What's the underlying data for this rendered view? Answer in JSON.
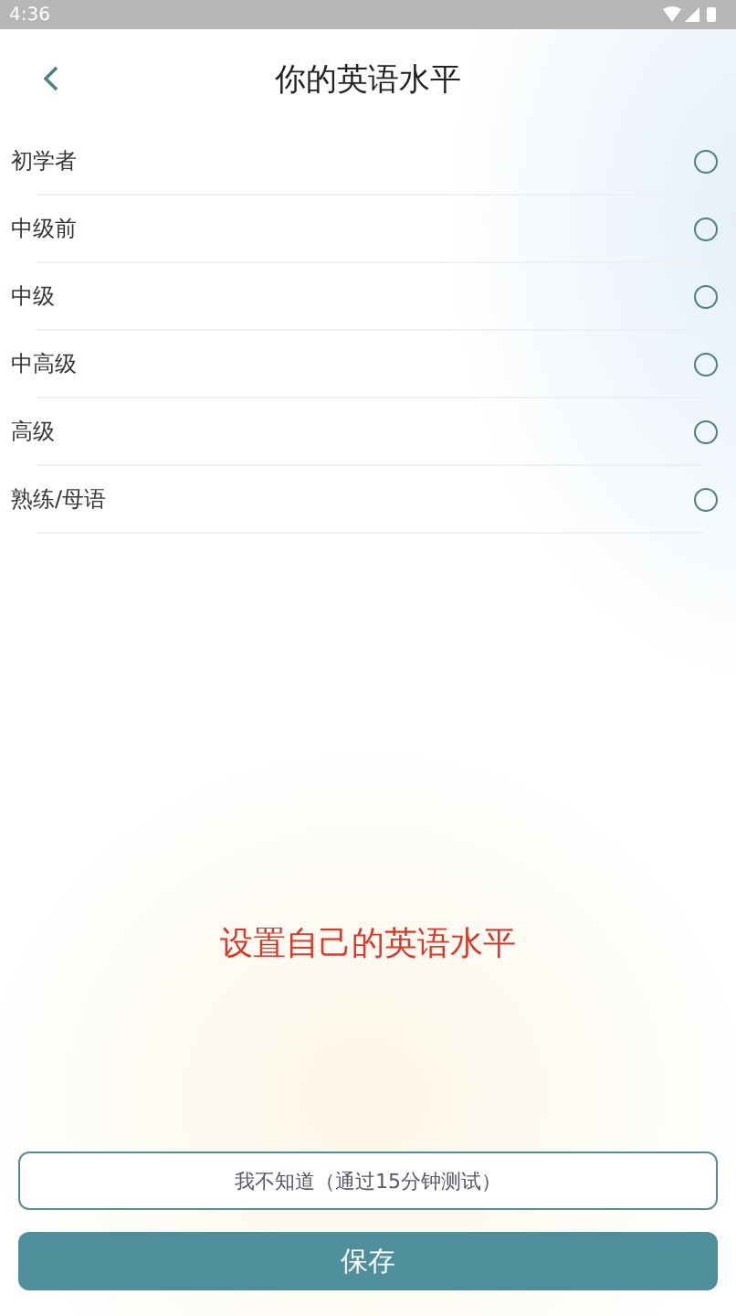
{
  "status_bar": {
    "time": "4:36"
  },
  "header": {
    "title": "你的英语水平"
  },
  "levels": [
    {
      "label": "初学者",
      "selected": false
    },
    {
      "label": "中级前",
      "selected": false
    },
    {
      "label": "中级",
      "selected": false
    },
    {
      "label": "中高级",
      "selected": false
    },
    {
      "label": "高级",
      "selected": false
    },
    {
      "label": "熟练/母语",
      "selected": false
    }
  ],
  "caption": "设置自己的英语水平",
  "buttons": {
    "unknown": "我不知道（通过15分钟测试）",
    "save": "保存"
  }
}
